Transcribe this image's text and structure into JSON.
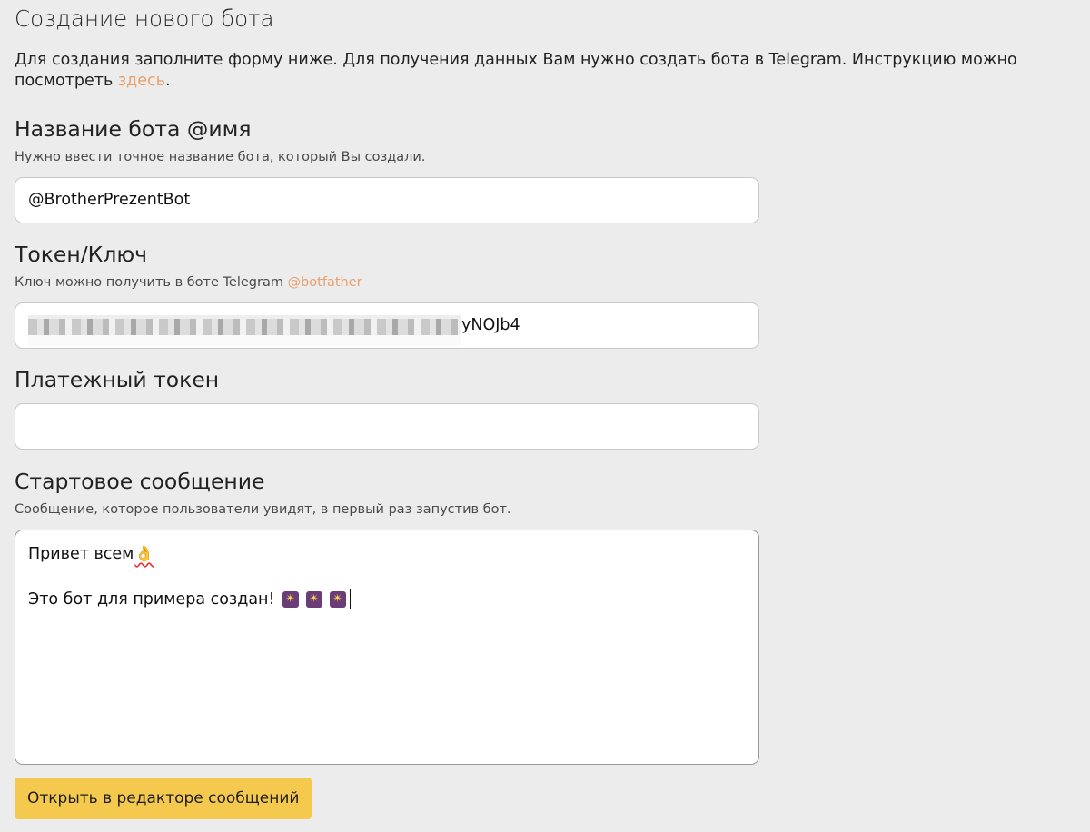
{
  "page": {
    "title": "Создание нового бота",
    "intro_text": "Для создания заполните форму ниже. Для получения данных Вам нужно создать бота в Telegram. Инструкцию можно посмотреть ",
    "intro_link": "здесь",
    "intro_end": "."
  },
  "bot_name": {
    "label": "Название бота @имя",
    "hint": "Нужно ввести точное название бота, который Вы создали.",
    "value": "@BrotherPrezentBot"
  },
  "token": {
    "label": "Токен/Ключ",
    "hint": "Ключ можно получить в боте Telegram ",
    "hint_link": "@botfather",
    "visible_tail": "yNOJb4"
  },
  "payment_token": {
    "label": "Платежный токен",
    "value": ""
  },
  "start_message": {
    "label": "Стартовое сообщение",
    "hint": "Сообщение, которое пользователи увидят, в первый раз запустив бот.",
    "line1": "Привет всем",
    "line1_emoji": "👌",
    "line2": "Это бот для примера создан!",
    "line2_emoji": "✴"
  },
  "actions": {
    "open_editor_label": "Открыть в редакторе сообщений"
  },
  "colors": {
    "background": "#ececec",
    "link": "#e9a06b",
    "button": "#f4c94d"
  }
}
